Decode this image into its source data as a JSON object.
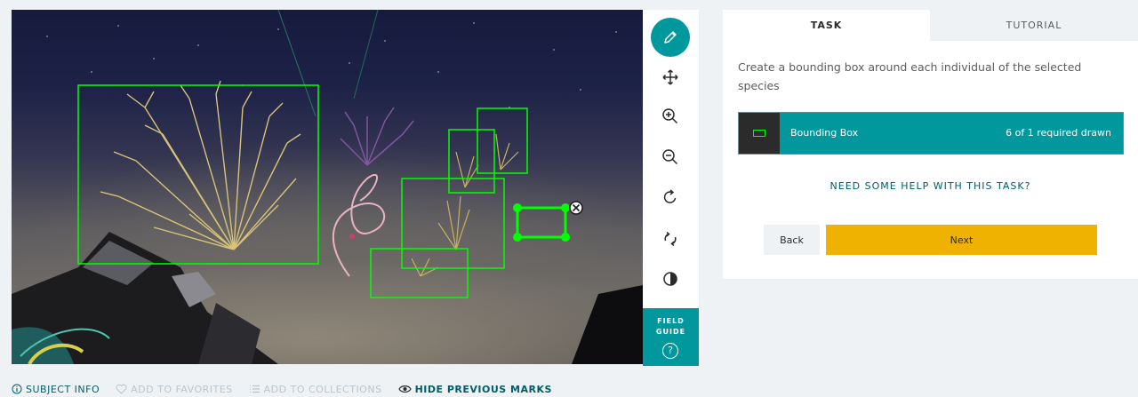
{
  "viewer": {
    "toolbar": {
      "tools": [
        {
          "icon": "pencil-icon",
          "name": "annotate-tool",
          "active": true
        },
        {
          "icon": "move-icon",
          "name": "move-tool",
          "active": false
        },
        {
          "icon": "zoom-in-icon",
          "name": "zoom-in-tool",
          "active": false
        },
        {
          "icon": "zoom-out-icon",
          "name": "zoom-out-tool",
          "active": false
        },
        {
          "icon": "rotate-icon",
          "name": "rotate-tool",
          "active": false
        },
        {
          "icon": "reset-icon",
          "name": "reset-tool",
          "active": false
        },
        {
          "icon": "invert-icon",
          "name": "invert-tool",
          "active": false
        }
      ],
      "field_guide_line1": "FIELD",
      "field_guide_line2": "GUIDE",
      "field_guide_help": "?"
    },
    "mark_color": "#00ff00"
  },
  "bottom_bar": {
    "subject_info": "SUBJECT INFO",
    "add_to_favorites": "ADD TO FAVORITES",
    "add_to_collections": "ADD TO COLLECTIONS",
    "hide_previous_marks": "HIDE PREVIOUS MARKS"
  },
  "task_panel": {
    "tabs": {
      "task": "TASK",
      "tutorial": "TUTORIAL"
    },
    "instructions": "Create a bounding box around each individual of the selected species",
    "tool_option": {
      "label": "Bounding Box",
      "count": "6 of 1 required drawn",
      "swatch_color": "#00ff00"
    },
    "help_link": "NEED SOME HELP WITH THIS TASK?",
    "back_button": "Back",
    "next_button": "Next"
  },
  "colors": {
    "accent": "#00979d",
    "next_button": "#f0b200",
    "link": "#005d69",
    "background": "#eff2f5"
  }
}
